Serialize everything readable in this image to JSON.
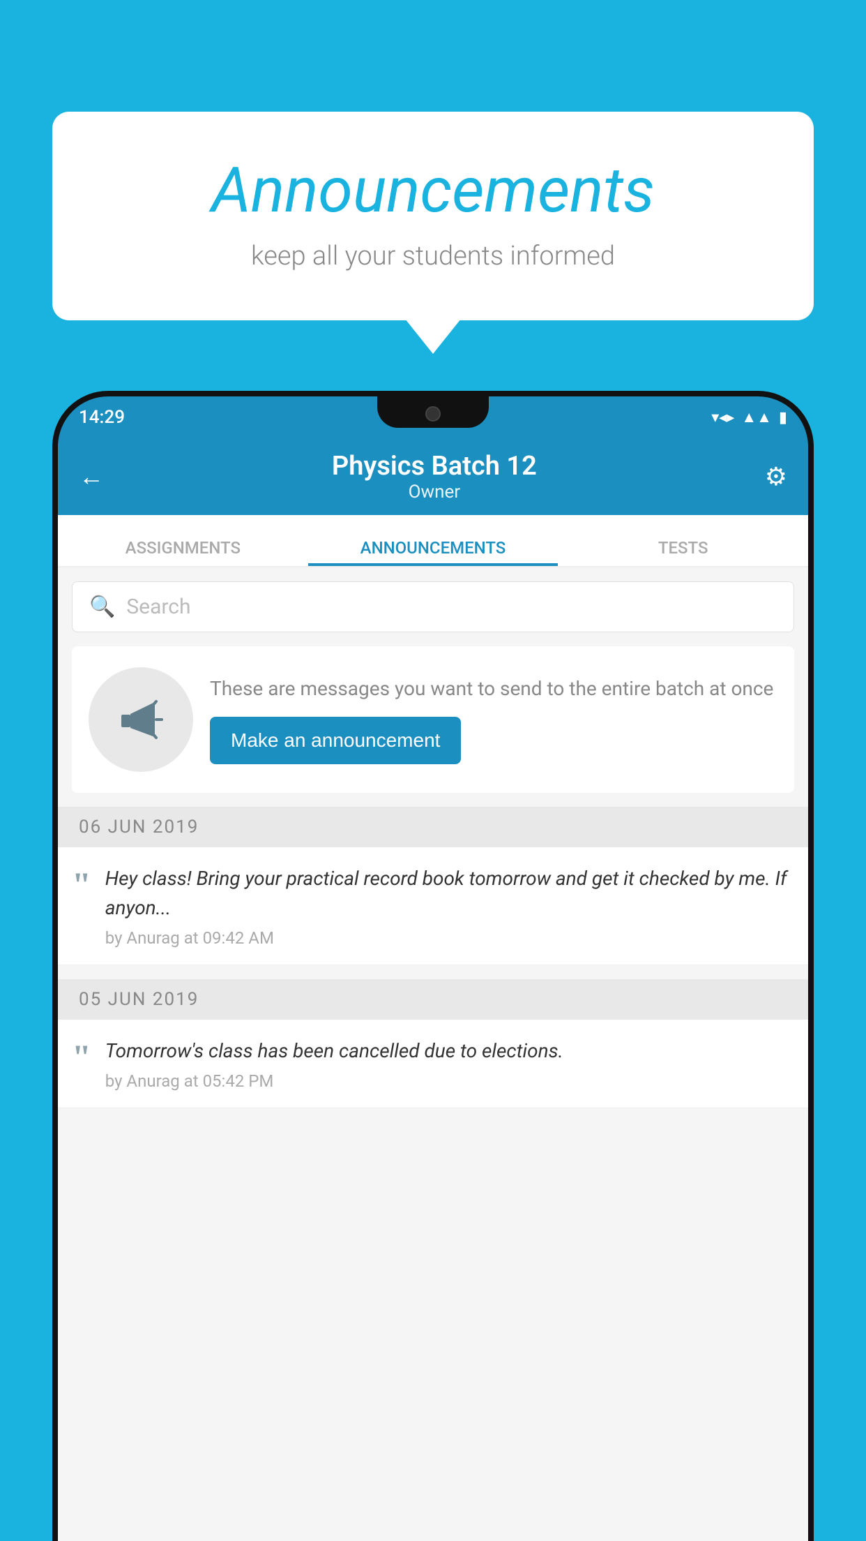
{
  "background_color": "#1ab3e0",
  "speech_bubble": {
    "title": "Announcements",
    "subtitle": "keep all your students informed"
  },
  "phone": {
    "status_bar": {
      "time": "14:29",
      "icons": [
        "wifi",
        "signal",
        "battery"
      ]
    },
    "app_bar": {
      "title": "Physics Batch 12",
      "subtitle": "Owner",
      "back_label": "←",
      "settings_label": "⚙"
    },
    "tabs": [
      {
        "label": "ASSIGNMENTS",
        "active": false
      },
      {
        "label": "ANNOUNCEMENTS",
        "active": true
      },
      {
        "label": "TESTS",
        "active": false
      },
      {
        "label": "...",
        "active": false
      }
    ],
    "search": {
      "placeholder": "Search"
    },
    "announcement_prompt": {
      "description": "These are messages you want to send to the entire batch at once",
      "button_label": "Make an announcement"
    },
    "announcements": [
      {
        "date": "06  JUN  2019",
        "text": "Hey class! Bring your practical record book tomorrow and get it checked by me. If anyon...",
        "meta": "by Anurag at 09:42 AM"
      },
      {
        "date": "05  JUN  2019",
        "text": "Tomorrow's class has been cancelled due to elections.",
        "meta": "by Anurag at 05:42 PM"
      }
    ]
  }
}
